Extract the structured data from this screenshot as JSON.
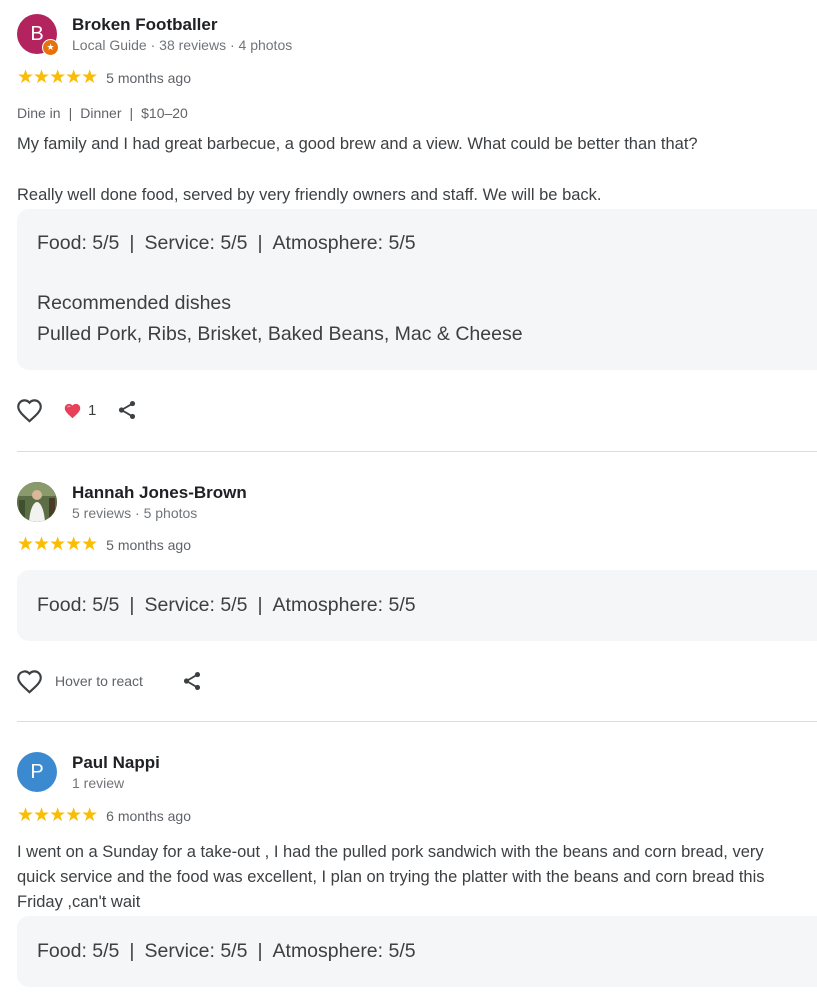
{
  "reviews": [
    {
      "initial": "B",
      "avatar_color": "#b3245f",
      "name": "Broken Footballer",
      "meta": "Local Guide · 38 reviews · 4 photos",
      "stars": "★★★★★",
      "when": "5 months ago",
      "attrs": [
        "Dine in",
        "Dinner",
        "$10–20"
      ],
      "body_lines": [
        "My family and I had great barbecue, a good brew and a view. What could be better than that?",
        "Really well done food, served by very friendly owners and staff. We will be back."
      ],
      "ratings": {
        "food": "Food: 5/5",
        "service": "Service: 5/5",
        "atmosphere": "Atmosphere: 5/5"
      },
      "recommended_label": "Recommended dishes",
      "recommended": "Pulled Pork, Ribs, Brisket, Baked Beans, Mac & Cheese",
      "reaction_count": "1"
    },
    {
      "avatar_color": "#6b7a55",
      "name": "Hannah Jones-Brown",
      "meta": "5 reviews · 5 photos",
      "stars": "★★★★★",
      "when": "5 months ago",
      "ratings": {
        "food": "Food: 5/5",
        "service": "Service: 5/5",
        "atmosphere": "Atmosphere: 5/5"
      },
      "hover_label": "Hover to react"
    },
    {
      "initial": "P",
      "avatar_color": "#3b8ad0",
      "name": "Paul Nappi",
      "meta": "1 review",
      "stars": "★★★★★",
      "when": "6 months ago",
      "body_lines": [
        "I went on a Sunday for a take-out , I had the pulled pork sandwich with the beans and corn bread, very",
        "quick service and the food was excellent, I plan on trying the platter with the beans and corn bread this",
        "Friday ,can't wait"
      ],
      "ratings": {
        "food": "Food: 5/5",
        "service": "Service: 5/5",
        "atmosphere": "Atmosphere: 5/5"
      }
    }
  ],
  "separator": "|",
  "icons": {
    "heart": "heart-outline-icon",
    "reaction": "red-heart-reaction-icon",
    "share": "share-icon",
    "badge": "local-guide-star-icon"
  }
}
